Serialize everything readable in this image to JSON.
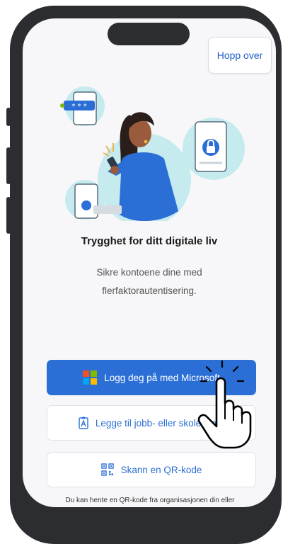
{
  "header": {
    "skip_label": "Hopp over"
  },
  "hero": {
    "title": "Trygghet for ditt digitale liv",
    "subtitle": "Sikre kontoene dine med flerfaktorautentisering."
  },
  "actions": {
    "microsoft_signin_label": "Logg deg på med Microsoft",
    "add_work_account_label": "Legge til jobb- eller skolekonto",
    "scan_qr_label": "Skann en QR-kode"
  },
  "footer": {
    "note": "Du kan hente en QR-kode fra organisasjonen din eller kontoleverandøren, for eksempel Microsoft, Google"
  },
  "colors": {
    "accent": "#2b6fd6",
    "ms_red": "#f25022",
    "ms_green": "#7fba00",
    "ms_blue": "#00a4ef",
    "ms_yellow": "#ffb900"
  },
  "icons": [
    "microsoft-logo-icon",
    "badge-icon",
    "qr-code-icon",
    "pointer-hand-icon"
  ]
}
